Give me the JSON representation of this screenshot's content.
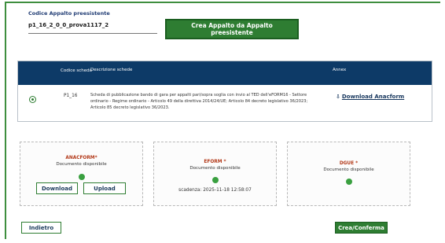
{
  "form": {
    "label": "Codice Appalto preesistente",
    "value": "p1_16_2_0_0_prova1117_2",
    "create_button": "Crea Appalto da Appalto preesistente"
  },
  "table": {
    "headers": {
      "code": "Codice scheda",
      "description": "Descrizione schede",
      "annex": "Annex"
    },
    "row": {
      "code": "P1_16",
      "description": "Scheda di pubblicazione bando di gara per appalti pari/sopra soglia con invio al TED dell'eFORM16 - Settore ordinario - Regime ordinario - Articolo 49 della direttiva 2014/24/UE; Articolo 84 decreto legislativo 36/2023; Articolo 85 decreto legislativo 36/2023.",
      "download_label": "Download Anacform"
    }
  },
  "cards": {
    "anacform": {
      "title": "ANACFORM*",
      "status": "Documento disponibile",
      "download": "Download",
      "upload": "Upload"
    },
    "eform": {
      "title": "EFORM *",
      "status": "Documento disponibile",
      "deadline": "scadenza: 2025-11-18 12:58:07"
    },
    "dgue": {
      "title": "DGUE *",
      "status": "Documento disponibile"
    }
  },
  "actions": {
    "back": "Indietro",
    "confirm": "Crea/Conferma"
  },
  "colors": {
    "accent": "#2e7d32",
    "table_header": "#0d3a67",
    "status_ok": "#3aa040",
    "required_title": "#b33a1a"
  }
}
